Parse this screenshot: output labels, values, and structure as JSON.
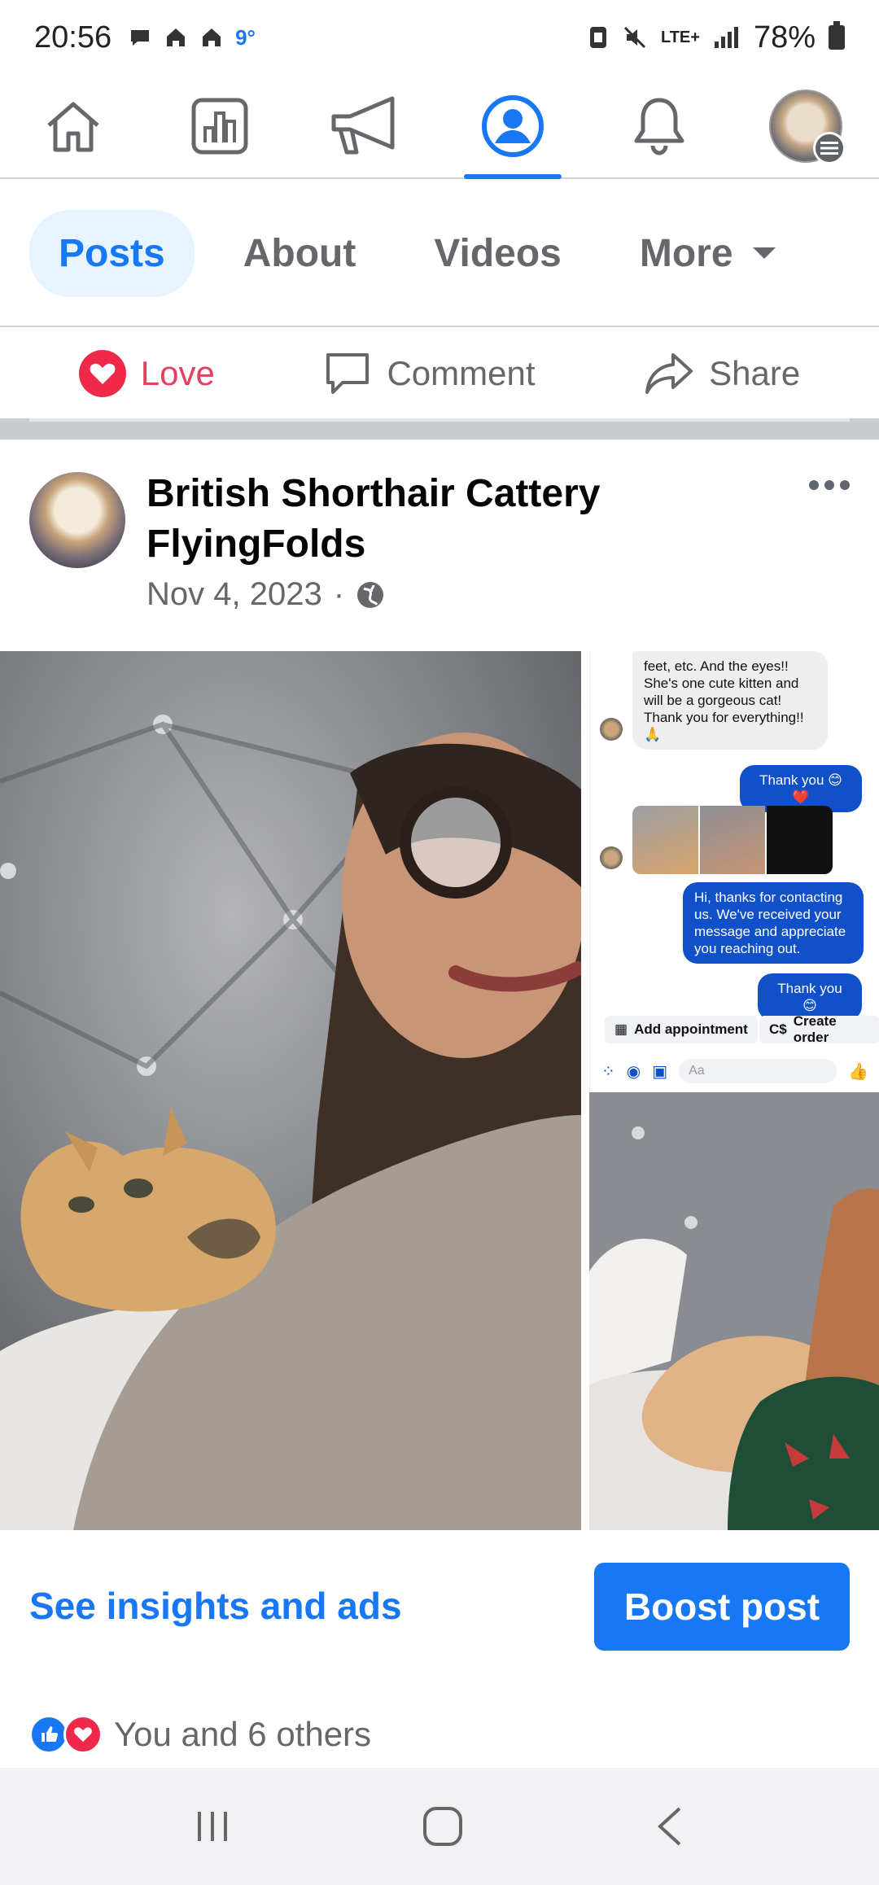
{
  "status_bar": {
    "time": "20:56",
    "temperature": "9°",
    "network": "LTE+",
    "battery": "78%"
  },
  "top_nav": {
    "items": [
      "home-icon",
      "dashboard-icon",
      "megaphone-icon",
      "profile-icon",
      "bell-icon",
      "account-avatar"
    ],
    "active": "profile-icon"
  },
  "tabs": {
    "items": [
      {
        "label": "Posts"
      },
      {
        "label": "About"
      },
      {
        "label": "Videos"
      },
      {
        "label": "More"
      }
    ],
    "active": "Posts"
  },
  "actions": {
    "love_label": "Love",
    "comment_label": "Comment",
    "share_label": "Share"
  },
  "post": {
    "author": "British Shorthair Cattery FlyingFolds",
    "date": "Nov 4, 2023",
    "privacy_icon": "globe-icon"
  },
  "chat": {
    "msg1": "feet, etc. And the eyes!! She's one cute kitten and will be a gorgeous cat! Thank you for everything!! 🙏",
    "msg2": "Thank you 😊 ❤️",
    "msg3": "Hi, thanks for contacting us. We've received your message and appreciate you reaching out.",
    "msg4": "Thank you 😊",
    "pill1": "Add appointment",
    "pill2": "Create order",
    "input_placeholder": "Aa"
  },
  "footer": {
    "insights_label": "See insights and ads",
    "boost_label": "Boost post"
  },
  "reactions": {
    "text": "You and 6 others"
  },
  "colors": {
    "accent": "#1877f2",
    "love": "#f02849",
    "secondary_text": "#65676b"
  }
}
